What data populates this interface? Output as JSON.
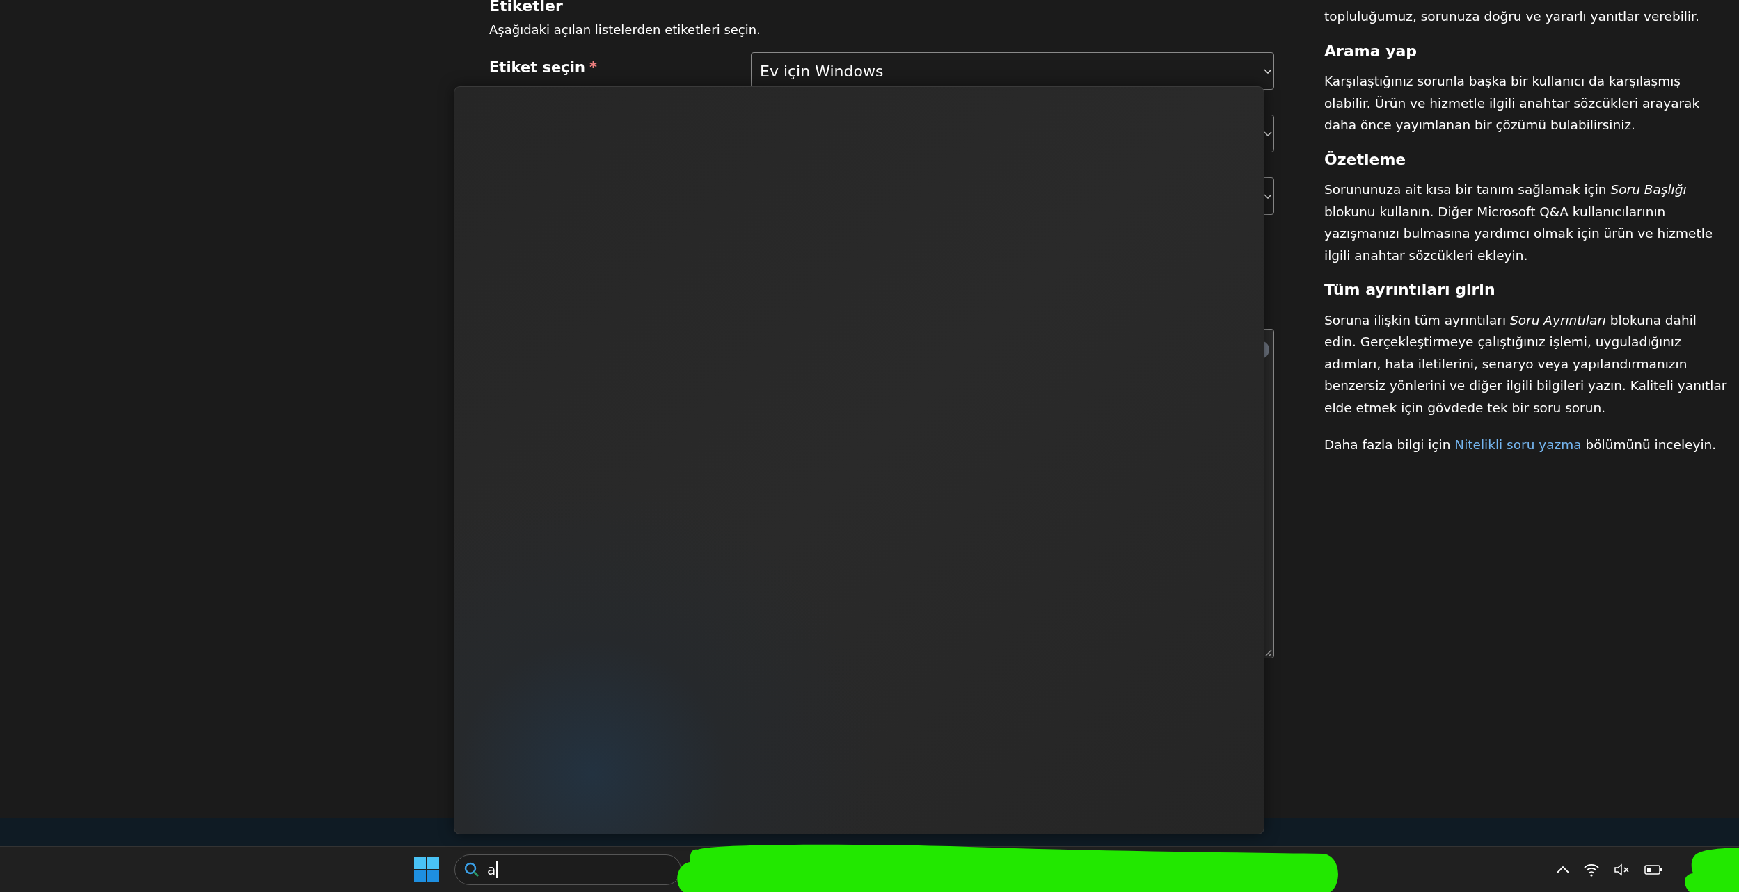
{
  "form": {
    "heading": "Etiketler",
    "description": "Aşağıdaki açılan listelerden etiketleri seçin.",
    "rows": [
      {
        "label": "Etiket seçin",
        "required_mark": "*",
        "field": {
          "kind": "select",
          "value": "Ev için Windows"
        }
      },
      {
        "field": {
          "kind": "select"
        }
      },
      {
        "field": {
          "kind": "select"
        }
      },
      {
        "field": {
          "kind": "textarea"
        }
      }
    ]
  },
  "guide": {
    "intro": "topluluğumuz, sorunuza doğru ve yararlı yanıtlar verebilir.",
    "sections": [
      {
        "heading": "Arama yap",
        "text": "Karşılaştığınız sorunla başka bir kullanıcı da karşılaşmış olabilir. Ürün ve hizmetle ilgili anahtar sözcükleri arayarak daha önce yayımlanan bir çözümü bulabilirsiniz."
      },
      {
        "heading": "Özetleme",
        "text": "Sorununuza ait kısa bir tanım sağlamak için *Soru Başlığı* blokunu kullanın. Diğer Microsoft Q&A kullanıcılarının yazışmanızı bulmasına yardımcı olmak için ürün ve hizmetle ilgili anahtar sözcükleri ekleyin."
      },
      {
        "heading": "Tüm ayrıntıları girin",
        "text": "Soruna ilişkin tüm ayrıntıları *Soru Ayrıntıları* blokuna dahil edin. Gerçekleştirmeye çalıştığınız işlemi, uyguladığınız adımları, hata iletilerini, senaryo veya yapılandırmanızın benzersiz yönlerini ve diğer ilgili bilgileri yazın. Kaliteli yanıtlar elde etmek için gövdede tek bir soru sorun."
      }
    ],
    "more": {
      "before": "Daha fazla bilgi için",
      "link": "Nitelikli soru yazma",
      "after": "bölümünü inceleyin."
    }
  },
  "taskbar": {
    "search": {
      "value": "a"
    }
  }
}
